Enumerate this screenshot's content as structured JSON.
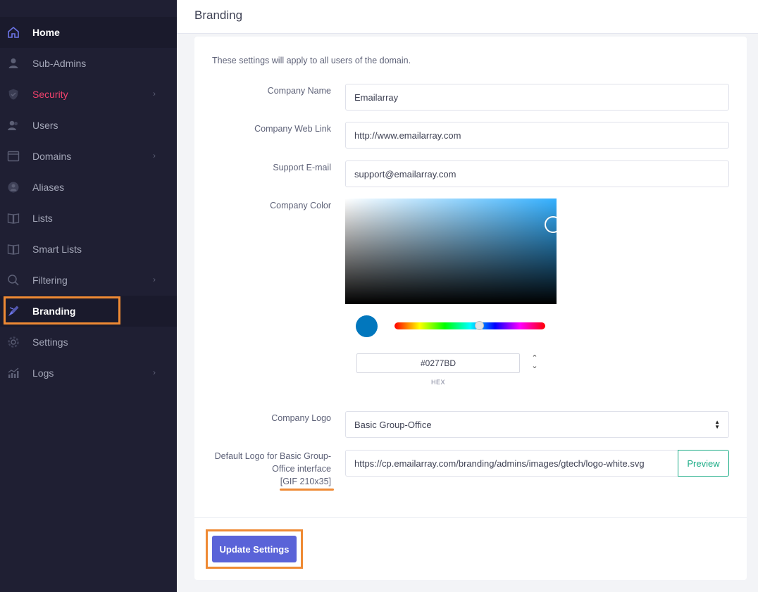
{
  "sidebar": {
    "items": [
      {
        "label": "Home",
        "icon": "home-icon"
      },
      {
        "label": "Sub-Admins",
        "icon": "user-icon"
      },
      {
        "label": "Security",
        "icon": "shield-icon",
        "chevron": "›"
      },
      {
        "label": "Users",
        "icon": "users-icon"
      },
      {
        "label": "Domains",
        "icon": "window-icon",
        "chevron": "›"
      },
      {
        "label": "Aliases",
        "icon": "aliases-icon"
      },
      {
        "label": "Lists",
        "icon": "book-icon"
      },
      {
        "label": "Smart Lists",
        "icon": "book-icon"
      },
      {
        "label": "Filtering",
        "icon": "search-icon",
        "chevron": "›"
      },
      {
        "label": "Branding",
        "icon": "brush-icon"
      },
      {
        "label": "Settings",
        "icon": "gear-icon"
      },
      {
        "label": "Logs",
        "icon": "chart-icon",
        "chevron": "›"
      }
    ],
    "security_color": "#f1416c"
  },
  "header": {
    "title": "Branding"
  },
  "form": {
    "intro": "These settings will apply to all users of the domain.",
    "company_name": {
      "label": "Company Name",
      "value": "Emailarray"
    },
    "company_web_link": {
      "label": "Company Web Link",
      "value": "http://www.emailarray.com"
    },
    "support_email": {
      "label": "Support E-mail",
      "value": "support@emailarray.com"
    },
    "company_color": {
      "label": "Company Color",
      "hex": "#0277BD",
      "hex_label": "HEX",
      "swatch_color": "#0277BD"
    },
    "company_logo": {
      "label": "Company Logo",
      "selected": "Basic Group-Office"
    },
    "default_logo": {
      "label_line1": "Default Logo for Basic Group-",
      "label_line2": "Office interface",
      "label_line3": "[GIF 210x35]",
      "value": "https://cp.emailarray.com/branding/admins/images/gtech/logo-white.svg",
      "preview_label": "Preview"
    },
    "update_label": "Update Settings"
  },
  "colors": {
    "accent": "#5a63d8",
    "highlight": "#ef8a34",
    "preview_green": "#1bac86"
  }
}
